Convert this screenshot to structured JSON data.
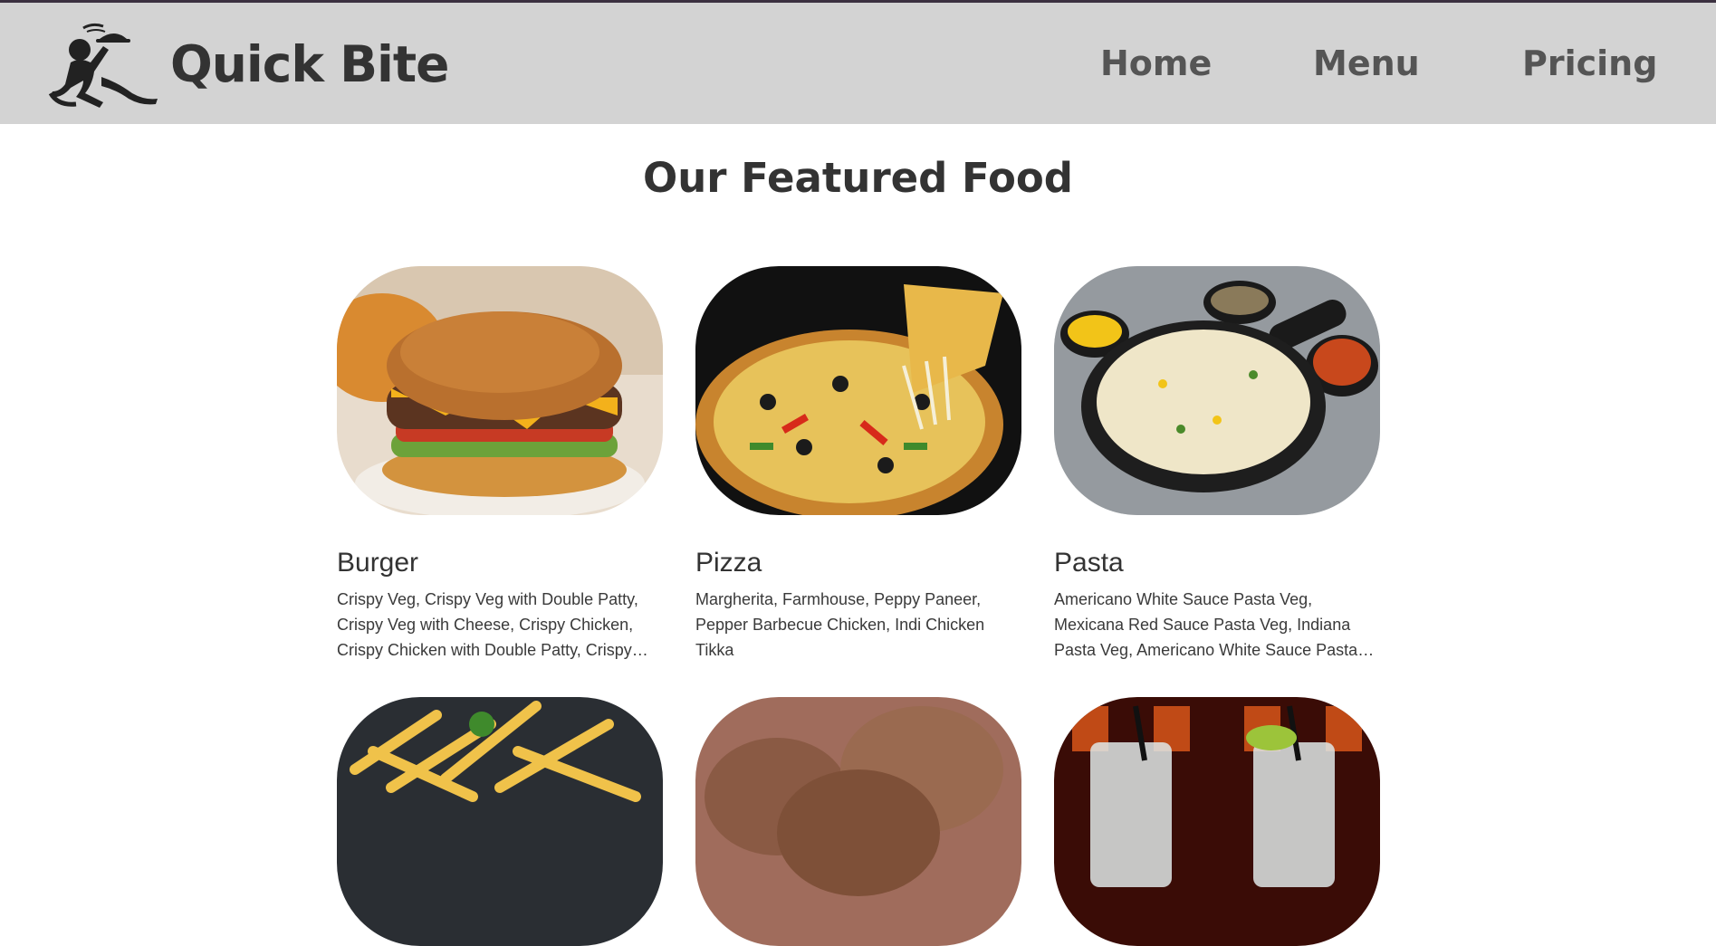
{
  "header": {
    "brand": "Quick Bite",
    "logo_icon": "running-waiter-icon",
    "nav": [
      {
        "label": "Home"
      },
      {
        "label": "Menu"
      },
      {
        "label": "Pricing"
      }
    ]
  },
  "featured": {
    "title": "Our Featured Food",
    "items": [
      {
        "name": "Burger",
        "description": "Crispy Veg, Crispy Veg with Double Patty, Crispy Veg with Cheese, Crispy Chicken, Crispy Chicken with Double Patty, Crispy Chicken with Cheese",
        "image": "burger-photo"
      },
      {
        "name": "Pizza",
        "description": "Margherita, Farmhouse, Peppy Paneer, Pepper Barbecue Chicken, Indi Chicken Tikka",
        "image": "pizza-photo"
      },
      {
        "name": "Pasta",
        "description": "Americano White Sauce Pasta Veg, Mexicana Red Sauce Pasta Veg, Indiana Pasta Veg, Americano White Sauce Pasta Chicken",
        "image": "pasta-photo"
      },
      {
        "image": "fries-photo"
      },
      {
        "image": "ice-cream-photo"
      },
      {
        "image": "mocktail-photo"
      }
    ]
  },
  "colors": {
    "header_bg": "#d3d3d3",
    "text_dark": "#333333",
    "nav_text": "#555555"
  }
}
